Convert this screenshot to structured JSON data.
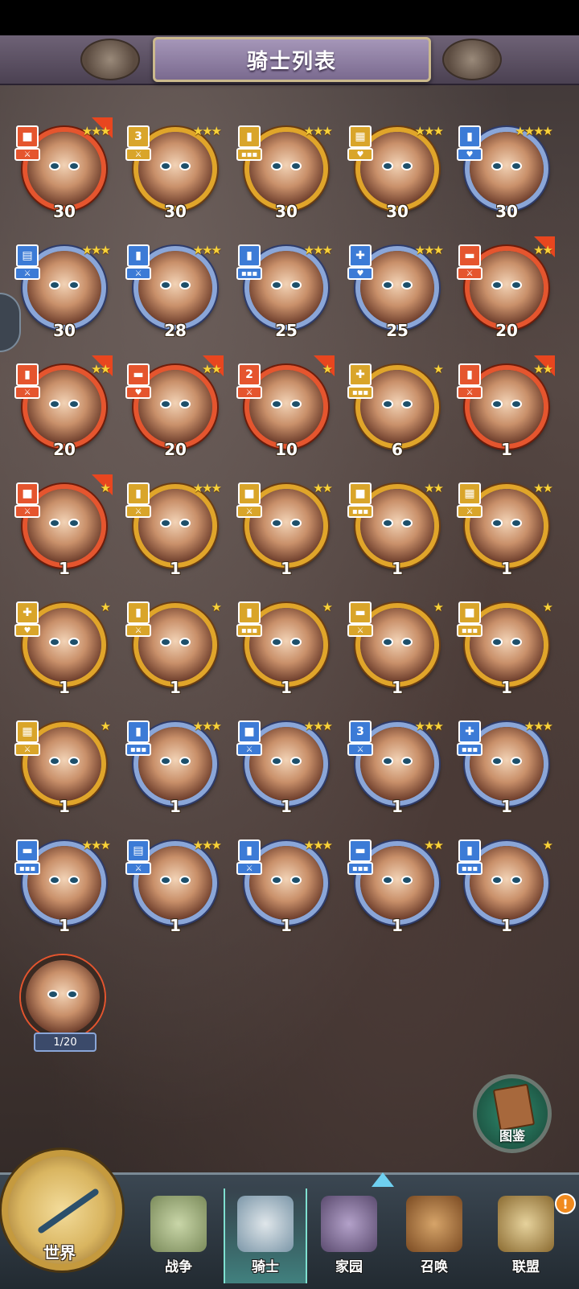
{
  "header": {
    "title": "骑士列表"
  },
  "knights": [
    {
      "level": "30",
      "stars": "★★★",
      "frame": "red",
      "badge_color": "#e5552e",
      "badge_icon": "sword",
      "badge_mark": "■",
      "flag": true
    },
    {
      "level": "30",
      "stars": "★★★",
      "frame": "gold",
      "badge_color": "#d9a52a",
      "badge_icon": "sword",
      "badge_mark": "3",
      "flag": false
    },
    {
      "level": "30",
      "stars": "★★★",
      "frame": "gold",
      "badge_color": "#d9a52a",
      "badge_icon": "shield",
      "badge_mark": "▮",
      "flag": false
    },
    {
      "level": "30",
      "stars": "★★★",
      "frame": "gold",
      "badge_color": "#d9a52a",
      "badge_icon": "heart",
      "badge_mark": "▦",
      "flag": false
    },
    {
      "level": "30",
      "stars": "★★★★",
      "frame": "blue",
      "badge_color": "#3c7bd6",
      "badge_icon": "heart",
      "badge_mark": "▮",
      "flag": false
    },
    {
      "level": "30",
      "stars": "★★★",
      "frame": "blue",
      "badge_color": "#3c7bd6",
      "badge_icon": "sword",
      "badge_mark": "▤",
      "flag": false
    },
    {
      "level": "28",
      "stars": "★★★",
      "frame": "blue",
      "badge_color": "#3c7bd6",
      "badge_icon": "sword",
      "badge_mark": "▮",
      "flag": false
    },
    {
      "level": "25",
      "stars": "★★★",
      "frame": "blue",
      "badge_color": "#3c7bd6",
      "badge_icon": "shield",
      "badge_mark": "▮",
      "flag": false
    },
    {
      "level": "25",
      "stars": "★★★",
      "frame": "blue",
      "badge_color": "#3c7bd6",
      "badge_icon": "heart",
      "badge_mark": "✚",
      "flag": false
    },
    {
      "level": "20",
      "stars": "★★",
      "frame": "red",
      "badge_color": "#e5552e",
      "badge_icon": "sword",
      "badge_mark": "▬",
      "flag": true
    },
    {
      "level": "20",
      "stars": "★★",
      "frame": "red",
      "badge_color": "#e5552e",
      "badge_icon": "sword",
      "badge_mark": "▮",
      "flag": true
    },
    {
      "level": "20",
      "stars": "★★",
      "frame": "red",
      "badge_color": "#e5552e",
      "badge_icon": "heart",
      "badge_mark": "▬",
      "flag": true
    },
    {
      "level": "10",
      "stars": "★",
      "frame": "red",
      "badge_color": "#e5552e",
      "badge_icon": "sword",
      "badge_mark": "2",
      "flag": true
    },
    {
      "level": "6",
      "stars": "★",
      "frame": "gold",
      "badge_color": "#d9a52a",
      "badge_icon": "shield",
      "badge_mark": "✚",
      "flag": false
    },
    {
      "level": "1",
      "stars": "★★",
      "frame": "red",
      "badge_color": "#e5552e",
      "badge_icon": "sword",
      "badge_mark": "▮",
      "flag": true
    },
    {
      "level": "1",
      "stars": "★",
      "frame": "red",
      "badge_color": "#e5552e",
      "badge_icon": "sword",
      "badge_mark": "■",
      "flag": true
    },
    {
      "level": "1",
      "stars": "★★★",
      "frame": "gold",
      "badge_color": "#d9a52a",
      "badge_icon": "sword",
      "badge_mark": "▮",
      "flag": false
    },
    {
      "level": "1",
      "stars": "★★",
      "frame": "gold",
      "badge_color": "#d9a52a",
      "badge_icon": "sword",
      "badge_mark": "■",
      "flag": false
    },
    {
      "level": "1",
      "stars": "★★",
      "frame": "gold",
      "badge_color": "#d9a52a",
      "badge_icon": "shield",
      "badge_mark": "■",
      "flag": false
    },
    {
      "level": "1",
      "stars": "★★",
      "frame": "gold",
      "badge_color": "#d9a52a",
      "badge_icon": "sword",
      "badge_mark": "▦",
      "flag": false
    },
    {
      "level": "1",
      "stars": "★",
      "frame": "gold",
      "badge_color": "#d9a52a",
      "badge_icon": "heart",
      "badge_mark": "✚",
      "flag": false
    },
    {
      "level": "1",
      "stars": "★",
      "frame": "gold",
      "badge_color": "#d9a52a",
      "badge_icon": "sword",
      "badge_mark": "▮",
      "flag": false
    },
    {
      "level": "1",
      "stars": "★",
      "frame": "gold",
      "badge_color": "#d9a52a",
      "badge_icon": "shield",
      "badge_mark": "▮",
      "flag": false
    },
    {
      "level": "1",
      "stars": "★",
      "frame": "gold",
      "badge_color": "#d9a52a",
      "badge_icon": "sword",
      "badge_mark": "▬",
      "flag": false
    },
    {
      "level": "1",
      "stars": "★",
      "frame": "gold",
      "badge_color": "#d9a52a",
      "badge_icon": "shield",
      "badge_mark": "■",
      "flag": false
    },
    {
      "level": "1",
      "stars": "★",
      "frame": "gold",
      "badge_color": "#d9a52a",
      "badge_icon": "sword",
      "badge_mark": "▦",
      "flag": false
    },
    {
      "level": "1",
      "stars": "★★★",
      "frame": "blue",
      "badge_color": "#3c7bd6",
      "badge_icon": "shield",
      "badge_mark": "▮",
      "flag": false
    },
    {
      "level": "1",
      "stars": "★★★",
      "frame": "blue",
      "badge_color": "#3c7bd6",
      "badge_icon": "sword",
      "badge_mark": "■",
      "flag": false
    },
    {
      "level": "1",
      "stars": "★★★",
      "frame": "blue",
      "badge_color": "#3c7bd6",
      "badge_icon": "sword",
      "badge_mark": "3",
      "flag": false
    },
    {
      "level": "1",
      "stars": "★★★",
      "frame": "blue",
      "badge_color": "#3c7bd6",
      "badge_icon": "shield",
      "badge_mark": "✚",
      "flag": false
    },
    {
      "level": "1",
      "stars": "★★★",
      "frame": "blue",
      "badge_color": "#3c7bd6",
      "badge_icon": "shield",
      "badge_mark": "▬",
      "flag": false
    },
    {
      "level": "1",
      "stars": "★★★",
      "frame": "blue",
      "badge_color": "#3c7bd6",
      "badge_icon": "sword",
      "badge_mark": "▤",
      "flag": false
    },
    {
      "level": "1",
      "stars": "★★★",
      "frame": "blue",
      "badge_color": "#3c7bd6",
      "badge_icon": "sword",
      "badge_mark": "▮",
      "flag": false
    },
    {
      "level": "1",
      "stars": "★★",
      "frame": "blue",
      "badge_color": "#3c7bd6",
      "badge_icon": "shield",
      "badge_mark": "▬",
      "flag": false
    },
    {
      "level": "1",
      "stars": "★",
      "frame": "blue",
      "badge_color": "#3c7bd6",
      "badge_icon": "shield",
      "badge_mark": "▮",
      "flag": false
    }
  ],
  "fragment_hero": {
    "progress": "1/20"
  },
  "codex": {
    "label": "图鉴"
  },
  "nav": {
    "world": "世界",
    "items": [
      {
        "label": "战争",
        "icon": "map-icon"
      },
      {
        "label": "骑士",
        "icon": "knight-icon"
      },
      {
        "label": "家园",
        "icon": "house-icon"
      },
      {
        "label": "召唤",
        "icon": "train-icon"
      },
      {
        "label": "联盟",
        "icon": "castle-icon"
      }
    ],
    "alert": "!"
  }
}
